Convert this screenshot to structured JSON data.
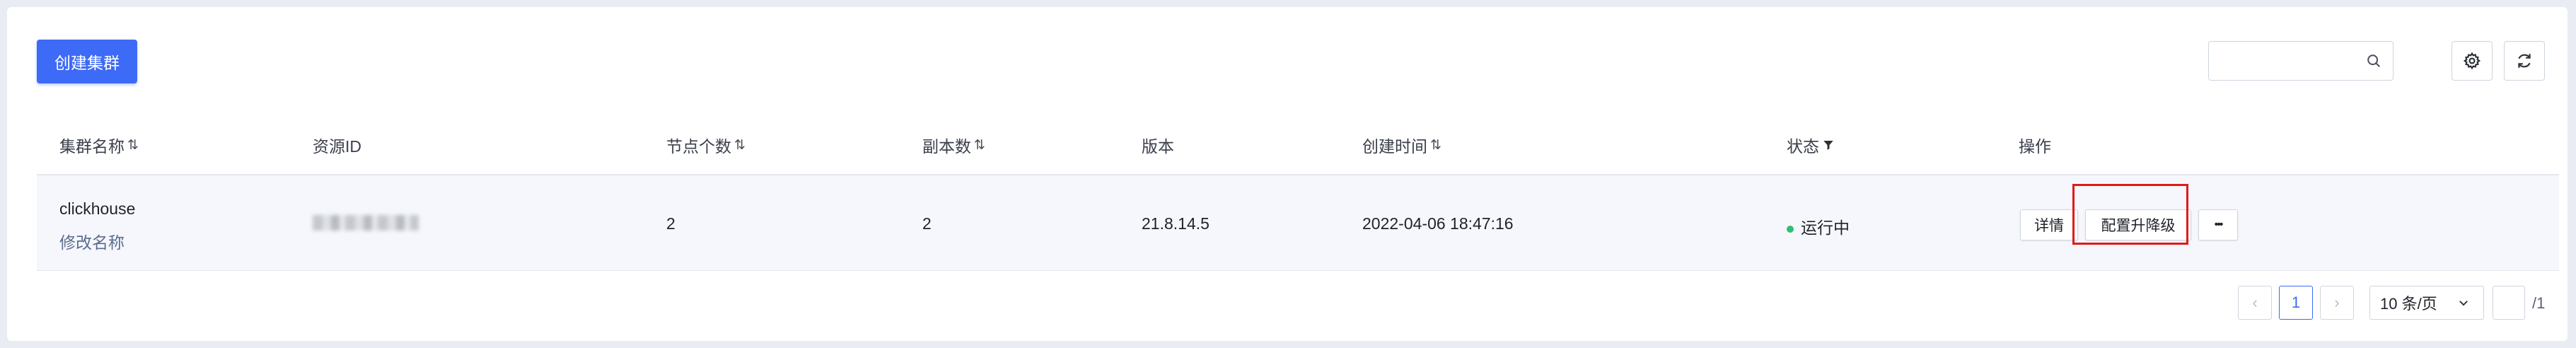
{
  "toolbar": {
    "create_label": "创建集群",
    "search_placeholder": "",
    "settings_icon": "gear-icon",
    "refresh_icon": "refresh-icon"
  },
  "table": {
    "columns": [
      "集群名称",
      "资源ID",
      "节点个数",
      "副本数",
      "版本",
      "创建时间",
      "状态",
      "操作"
    ],
    "rows": [
      {
        "name": "clickhouse",
        "rename": "修改名称",
        "nodes": "2",
        "replicas": "2",
        "version": "21.8.14.5",
        "created": "2022-04-06 18:47:16",
        "status": "运行中",
        "status_color": "#2fbf71",
        "actions": {
          "detail": "详情",
          "scale": "配置升降级",
          "more": "•••"
        }
      }
    ]
  },
  "pagination": {
    "prev": "‹",
    "current": "1",
    "next": "›",
    "page_size": "10 条/页",
    "total": "/1"
  }
}
